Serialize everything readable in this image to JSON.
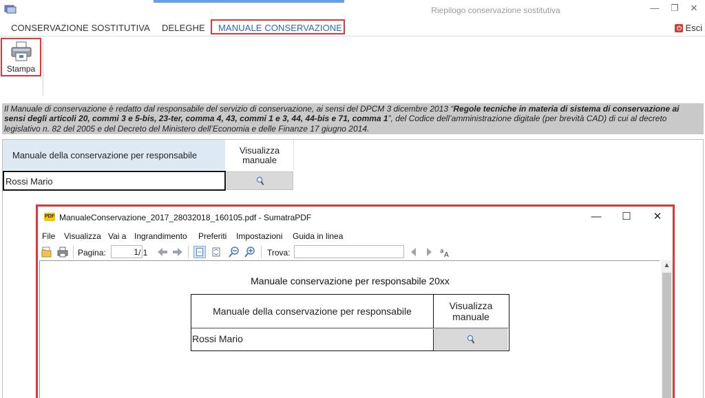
{
  "window": {
    "title": "Riepilogo conservazione sostitutiva"
  },
  "menu": {
    "tabs": [
      {
        "label": "CONSERVAZIONE SOSTITUTIVA",
        "active": false
      },
      {
        "label": "DELEGHE",
        "active": false
      },
      {
        "label": "MANUALE CONSERVAZIONE",
        "active": true
      }
    ],
    "exit_label": "Esci"
  },
  "ribbon": {
    "print_label": "Stampa",
    "print_icon": "printer-icon"
  },
  "info": {
    "intro": "Il Manuale di conservazione è redatto dal responsabile del servizio di conservazione, ai sensi del DPCM 3 dicembre 2013 “",
    "bold": "Regole tecniche in materia di sistema di conservazione ai sensi degli articoli 20, commi 3 e 5-bis, 23-ter, comma 4, 43, commi 1 e 3, 44, 44-bis e 71, comma 1",
    "outro": "”, del Codice dell’amministrazione digitale (per brevità CAD) di cui al decreto legislativo n. 82 del 2005 e del Decreto del Ministero dell’Economia e delle Finanze 17 giugno 2014."
  },
  "grid": {
    "col_name": "Manuale della conservazione per responsabile",
    "col_view": "Visualizza manuale",
    "rows": [
      {
        "name": "Rossi Mario",
        "action_icon": "magnifier-icon"
      }
    ]
  },
  "sumatra": {
    "title": "ManualeConservazione_2017_28032018_160105.pdf - SumatraPDF",
    "logo_text": "PDF",
    "menus": [
      "File",
      "Visualizza",
      "Vai a",
      "Ingrandimento",
      "Preferiti",
      "Impostazioni",
      "Guida in linea"
    ],
    "toolbar": {
      "page_label": "Pagina:",
      "page_value": "1",
      "page_total": "/ 1",
      "find_label": "Trova:"
    },
    "document": {
      "title": "Manuale conservazione per responsabile 20xx",
      "col_name": "Manuale della conservazione per responsabile",
      "col_view": "Visualizza manuale",
      "rows": [
        {
          "name": "Rossi Mario",
          "action_icon": "magnifier-icon"
        }
      ]
    }
  },
  "colors": {
    "highlight_border": "#e0383a",
    "active_tab": "#2a66b8",
    "grid_header_bg": "#ddeaf6",
    "banner_bg": "#c9c9c9"
  }
}
